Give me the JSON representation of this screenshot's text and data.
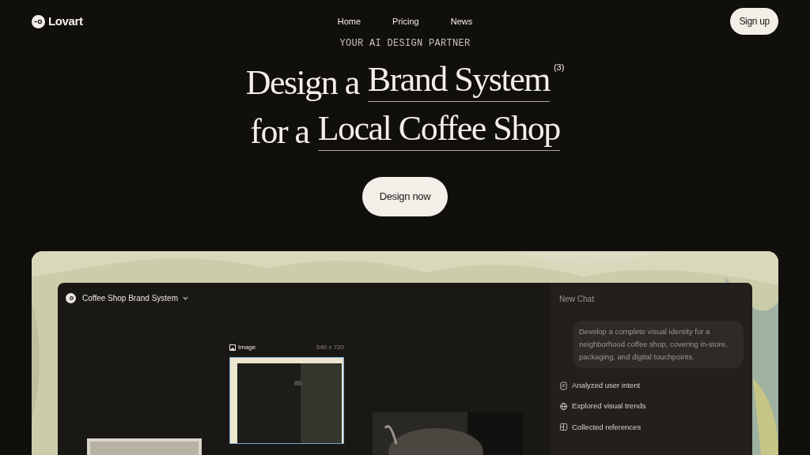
{
  "nav": {
    "brand": "Lovart",
    "links": [
      "Home",
      "Pricing",
      "News"
    ],
    "signup": "Sign up"
  },
  "hero": {
    "eyebrow": "YOUR AI DESIGN PARTNER",
    "line1_plain": "Design a",
    "line1_link": "Brand System",
    "counter": "(3)",
    "line2_plain": "for a",
    "line2_link": "Local Coffee Shop",
    "cta": "Design now"
  },
  "app": {
    "project": "Coffee Shop Brand System",
    "frame_label": "Image",
    "frame_size": "540 x 720",
    "chat": {
      "title": "New Chat",
      "prompt": "Develop a complete visual identity for a neighborhood coffee shop, covering in-store, packaging, and digital touchpoints.",
      "steps": [
        {
          "kind": "intent",
          "label": "Analyzed user intent"
        },
        {
          "kind": "trends",
          "label": "Explored visual trends"
        },
        {
          "kind": "references",
          "label": "Collected references"
        }
      ]
    }
  }
}
